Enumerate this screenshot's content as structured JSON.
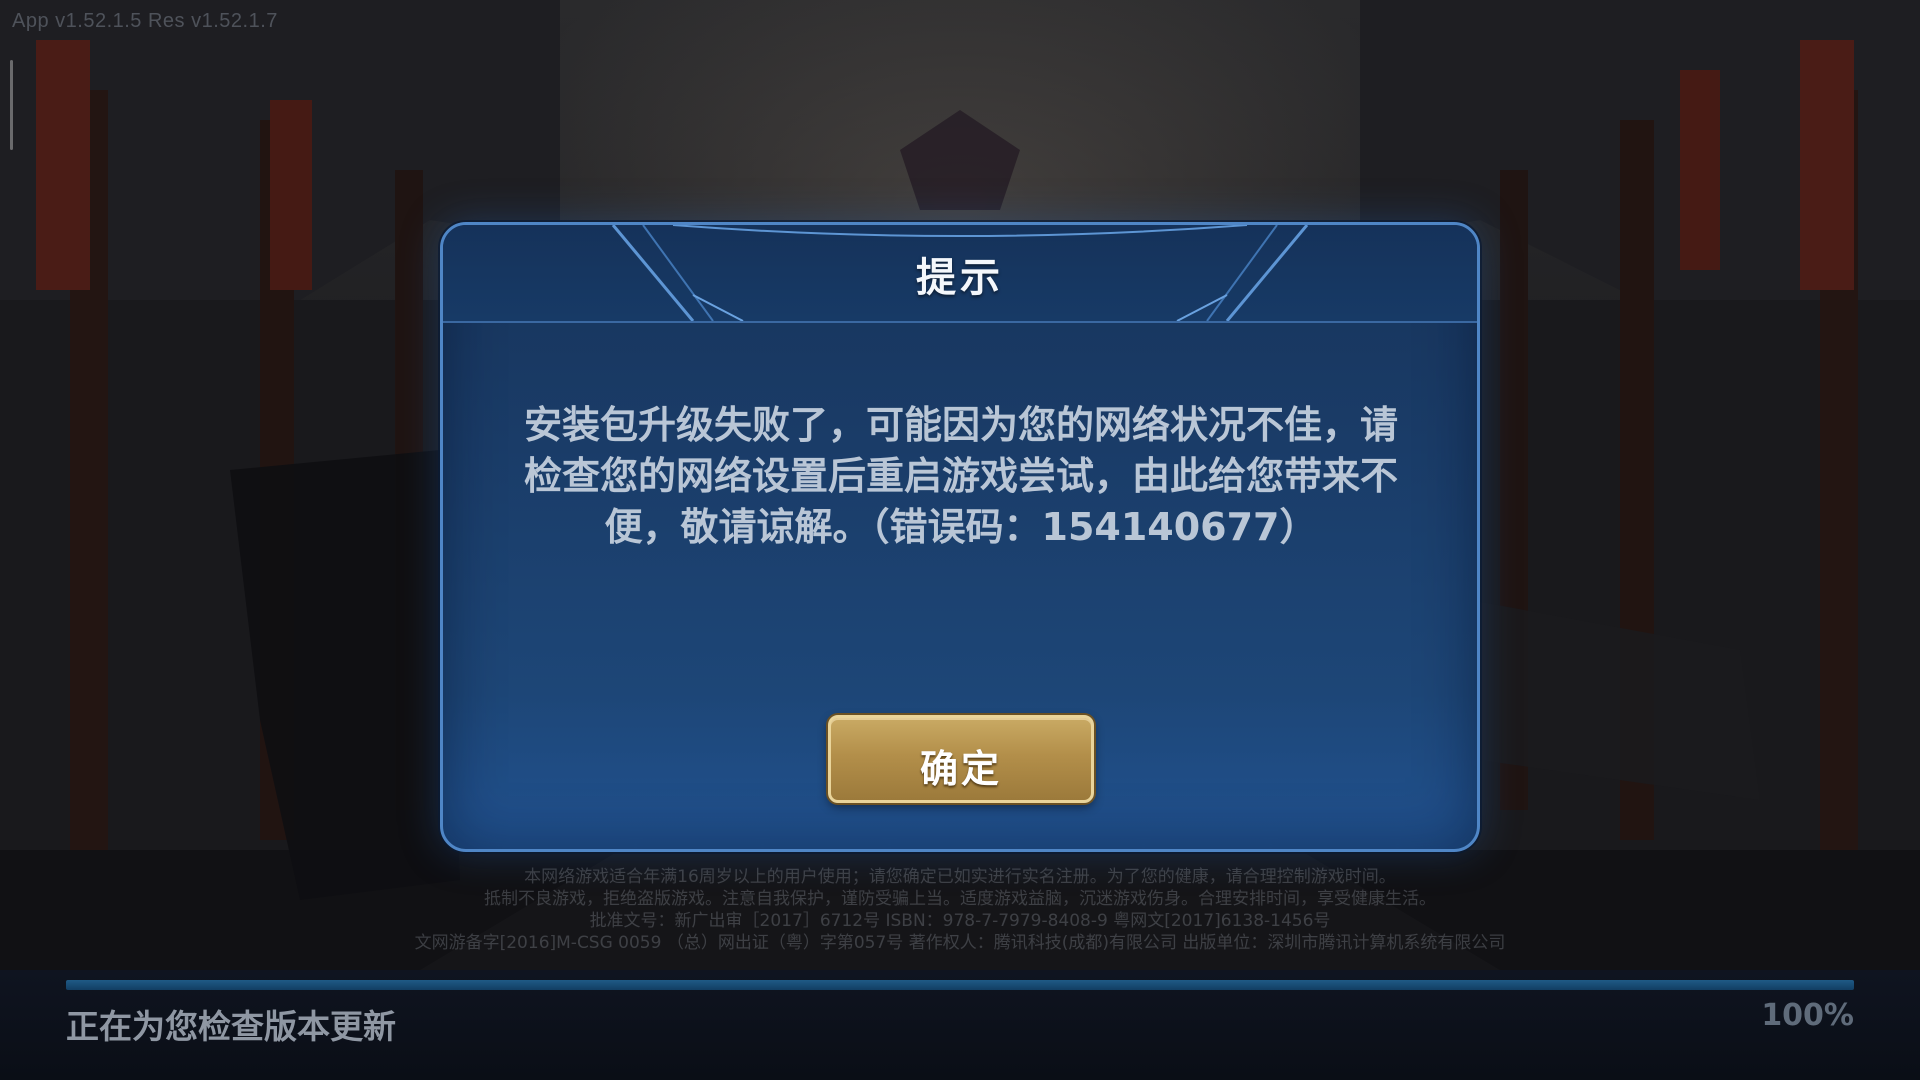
{
  "version_label": "App v1.52.1.5  Res v1.52.1.7",
  "dialog": {
    "title": "提示",
    "message": "安装包升级失败了，可能因为您的网络状况不佳，请检查您的网络设置后重启游戏尝试，由此给您带来不便，敬请谅解。（错误码：154140677）",
    "confirm_label": "确定"
  },
  "legal": {
    "line1": "本网络游戏适合年满16周岁以上的用户使用；请您确定已如实进行实名注册。为了您的健康，请合理控制游戏时间。",
    "line2": "抵制不良游戏，拒绝盗版游戏。注意自我保护，谨防受骗上当。适度游戏益脑，沉迷游戏伤身。合理安排时间，享受健康生活。",
    "line3": "批准文号：新广出审［2017］6712号  ISBN：978-7-7979-8408-9  粤网文[2017]6138-1456号",
    "line4": "文网游备字[2016]M-CSG 0059 （总）网出证（粤）字第057号  著作权人：腾讯科技(成都)有限公司  出版单位：深圳市腾讯计算机系统有限公司"
  },
  "loading": {
    "status_text": "正在为您检查版本更新",
    "progress_percent": "100%",
    "progress_value": 100
  },
  "colors": {
    "dialog_border": "#4f86c6",
    "dialog_bg": "#1a3c68",
    "button_gold": "#b38f4a",
    "message_text": "#b9c6d6"
  }
}
